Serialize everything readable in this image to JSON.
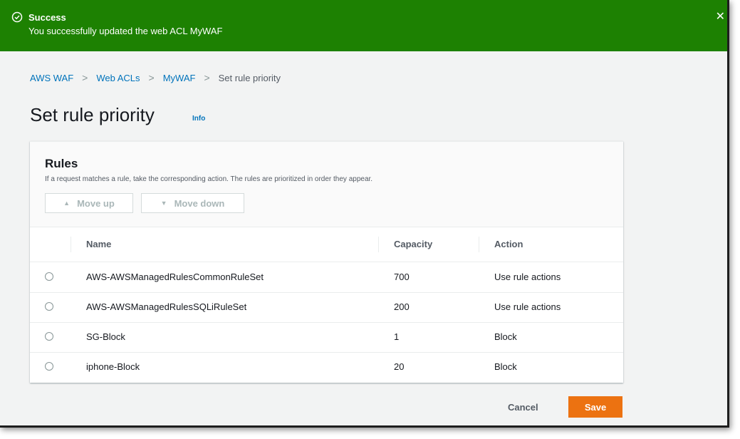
{
  "flash": {
    "type": "success",
    "title": "Success",
    "message": "You successfully updated the web ACL MyWAF",
    "icon": "check-circle-icon",
    "close_icon": "close-icon",
    "color": "#1d8102"
  },
  "breadcrumb": {
    "items": [
      "AWS WAF",
      "Web ACLs",
      "MyWAF"
    ],
    "current": "Set rule priority"
  },
  "page": {
    "title": "Set rule priority",
    "info": "Info"
  },
  "rules": {
    "title": "Rules",
    "description": "If a request matches a rule, take the corresponding action. The rules are prioritized in order they appear.",
    "move_up": "Move up",
    "move_down": "Move down",
    "columns": [
      "Name",
      "Capacity",
      "Action"
    ],
    "rows": [
      {
        "name": "AWS-AWSManagedRulesCommonRuleSet",
        "capacity": "700",
        "action": "Use rule actions"
      },
      {
        "name": "AWS-AWSManagedRulesSQLiRuleSet",
        "capacity": "200",
        "action": "Use rule actions"
      },
      {
        "name": "SG-Block",
        "capacity": "1",
        "action": "Block"
      },
      {
        "name": "iphone-Block",
        "capacity": "20",
        "action": "Block"
      }
    ]
  },
  "actions": {
    "cancel": "Cancel",
    "save": "Save",
    "save_color": "#ec7211"
  }
}
